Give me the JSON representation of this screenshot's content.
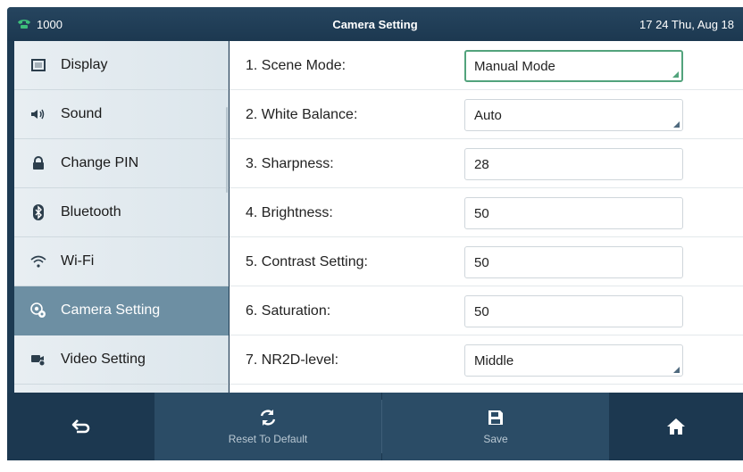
{
  "status_bar": {
    "account": "1000",
    "title": "Camera Setting",
    "datetime": "17 24 Thu, Aug 18"
  },
  "menu": {
    "items": [
      {
        "label": "Display",
        "icon": "display-icon"
      },
      {
        "label": "Sound",
        "icon": "speaker-icon"
      },
      {
        "label": "Change PIN",
        "icon": "lock-icon"
      },
      {
        "label": "Bluetooth",
        "icon": "bluetooth-icon"
      },
      {
        "label": "Wi-Fi",
        "icon": "wifi-icon"
      },
      {
        "label": "Camera Setting",
        "icon": "camera-icon",
        "active": true
      },
      {
        "label": "Video Setting",
        "icon": "video-icon"
      }
    ]
  },
  "settings": {
    "rows": [
      {
        "label": "1. Scene Mode:",
        "value": "Manual Mode",
        "type": "select",
        "focused": true
      },
      {
        "label": "2. White Balance:",
        "value": "Auto",
        "type": "select"
      },
      {
        "label": "3. Sharpness:",
        "value": "28",
        "type": "input"
      },
      {
        "label": "4. Brightness:",
        "value": "50",
        "type": "input"
      },
      {
        "label": "5. Contrast Setting:",
        "value": "50",
        "type": "input"
      },
      {
        "label": "6. Saturation:",
        "value": "50",
        "type": "input"
      },
      {
        "label": "7. NR2D-level:",
        "value": "Middle",
        "type": "select"
      }
    ]
  },
  "softkeys": {
    "back_icon": "back-arrow-icon",
    "reset_label": "Reset To Default",
    "reset_icon": "refresh-icon",
    "save_label": "Save",
    "save_icon": "save-icon",
    "home_icon": "home-icon"
  },
  "colors": {
    "bar_bg": "#1c3850",
    "active_item": "#6d8fa3",
    "focus_border": "#52a37c",
    "phone_icon": "#3dbf7a"
  }
}
